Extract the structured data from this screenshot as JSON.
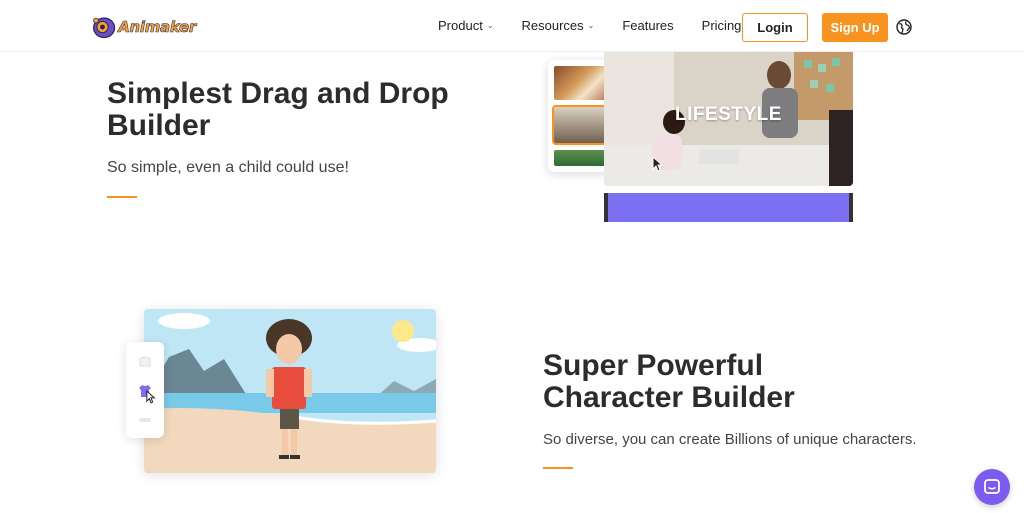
{
  "brand": {
    "name": "Animaker",
    "color": "#f5a623",
    "accent": "#f7931e",
    "purple": "#7b6ff2"
  },
  "nav": {
    "links": [
      {
        "label": "Product",
        "has_dropdown": true
      },
      {
        "label": "Resources",
        "has_dropdown": true
      },
      {
        "label": "Features",
        "has_dropdown": false
      },
      {
        "label": "Pricing",
        "has_dropdown": false
      }
    ],
    "login_label": "Login",
    "signup_label": "Sign Up",
    "globe_icon": "globe-icon"
  },
  "section1": {
    "title": "Simplest Drag and Drop Builder",
    "subtitle": "So simple, even a child could use!",
    "preview_label": "LIFESTYLE"
  },
  "section2": {
    "title": "Super Powerful Character Builder",
    "subtitle": "So diverse, you can create Billions of unique characters."
  },
  "chat": {
    "icon": "chat-icon"
  }
}
